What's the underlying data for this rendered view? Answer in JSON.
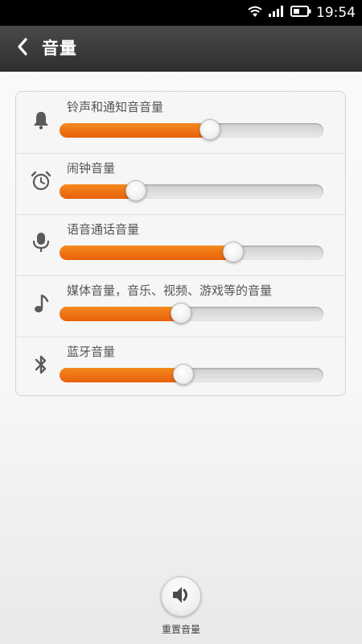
{
  "status_bar": {
    "time": "19:54",
    "icons": [
      "wifi-icon",
      "signal-icon",
      "battery-icon"
    ]
  },
  "header": {
    "title": "音量",
    "back_icon": "chevron-left-icon"
  },
  "sliders": [
    {
      "label": "铃声和通知音音量",
      "icon": "bell-icon",
      "level": 0.57
    },
    {
      "label": "闹钟音量",
      "icon": "alarm-clock-icon",
      "level": 0.29
    },
    {
      "label": "语音通话音量",
      "icon": "microphone-icon",
      "level": 0.66
    },
    {
      "label": "媒体音量，音乐、视频、游戏等的音量",
      "icon": "music-note-icon",
      "level": 0.46
    },
    {
      "label": "蓝牙音量",
      "icon": "bluetooth-icon",
      "level": 0.47
    }
  ],
  "reset": {
    "label": "重置音量",
    "icon": "speaker-icon"
  },
  "colors": {
    "accent": "#f07412",
    "header_bg": "#3a3a3a",
    "track": "#dcdcdc"
  }
}
